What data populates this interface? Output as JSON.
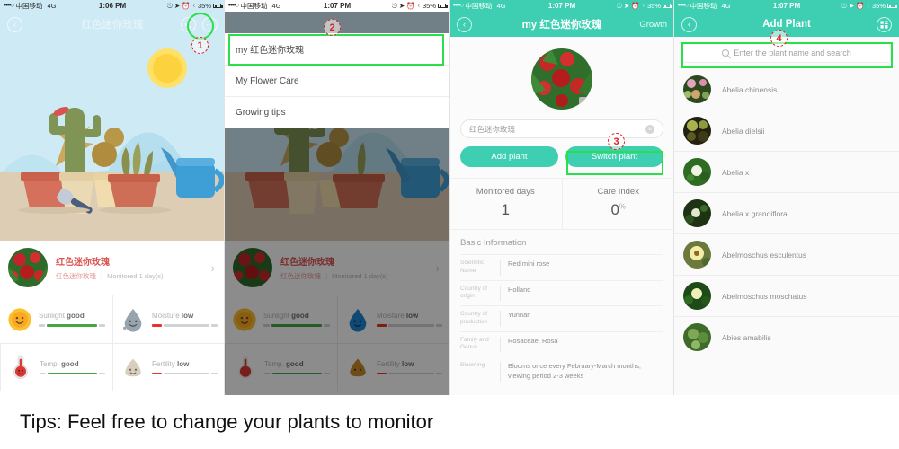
{
  "meta": {
    "caption": "Tips: Feel free to change your plants to monitor"
  },
  "status_bar": {
    "signal_dots": "••••○",
    "carrier": "中国移动",
    "network": "4G",
    "icons": [
      "rotate-lock-icon",
      "location-arrow-icon",
      "alarm-icon",
      "bluetooth-icon"
    ],
    "battery": "35%",
    "times": {
      "panel1": "1:06 PM",
      "panel2": "1:07 PM",
      "panel3": "1:07 PM",
      "panel4": "1:07 PM"
    }
  },
  "panel1": {
    "nav": {
      "back": "‹",
      "title": "红色迷你玫瑰",
      "share_icon": "share-icon",
      "more": "···"
    },
    "card": {
      "title": "红色迷你玫瑰",
      "sub_zh": "红色迷你玫瑰",
      "sub_sep": "|",
      "sub_en": "Monitored 1 day(s)",
      "chevron": "›"
    },
    "metrics": [
      {
        "icon": "sun-icon",
        "label": "Sunlight",
        "value": "good",
        "state": "good"
      },
      {
        "icon": "water-drop-icon",
        "label": "Moisture",
        "value": "low",
        "state": "low"
      },
      {
        "icon": "thermometer-icon",
        "label": "Temp.",
        "value": "good",
        "state": "good"
      },
      {
        "icon": "fertilizer-icon",
        "label": "Fertility",
        "value": "low",
        "state": "low"
      }
    ]
  },
  "panel2": {
    "menu": [
      {
        "label": "my 红色迷你玫瑰"
      },
      {
        "label": "My Flower Care"
      },
      {
        "label": "Growing tips"
      }
    ]
  },
  "panel3": {
    "nav": {
      "back": "‹",
      "title": "my 红色迷你玫瑰",
      "right_action": "Growth"
    },
    "name_field": {
      "value": "红色迷你玫瑰",
      "clear": "×"
    },
    "buttons": {
      "add": "Add plant",
      "switch": "Switch plant"
    },
    "kpis": [
      {
        "label": "Monitored days",
        "value": "1",
        "unit": ""
      },
      {
        "label": "Care Index",
        "value": "0",
        "unit": "%"
      }
    ],
    "section_title": "Basic Information",
    "info": [
      {
        "key": "Scientific Name",
        "value": "Red mini rose"
      },
      {
        "key": "Country of origin",
        "value": "Holland"
      },
      {
        "key": "Country of production",
        "value": "Yunnan"
      },
      {
        "key": "Family and Genus",
        "value": "Rosaceae, Rosa"
      },
      {
        "key": "Blooming",
        "value": "Blooms once every February-March months, viewing period 2-3 weeks"
      }
    ]
  },
  "panel4": {
    "nav": {
      "back": "‹",
      "title": "Add Plant",
      "right_icon": "grid-category-icon"
    },
    "search": {
      "placeholder": "Enter the plant name and search",
      "icon": "search-icon"
    },
    "plants": [
      {
        "name": "Abelia chinensis"
      },
      {
        "name": "Abelia dielsii"
      },
      {
        "name": "Abelia x"
      },
      {
        "name": "Abelia x grandiflora"
      },
      {
        "name": "Abelmoschus esculentus"
      },
      {
        "name": "Abelmoschus moschatus"
      },
      {
        "name": "Abies amabilis"
      }
    ]
  },
  "annotations": [
    {
      "number": "1"
    },
    {
      "number": "2"
    },
    {
      "number": "3"
    },
    {
      "number": "4"
    }
  ],
  "colors": {
    "brand_green": "#3ECFB2",
    "highlight_green": "#2AE04A",
    "annotation_red": "#E02020",
    "good": "#46A644",
    "low": "#E8332A",
    "sky": "#CDEAF5"
  }
}
